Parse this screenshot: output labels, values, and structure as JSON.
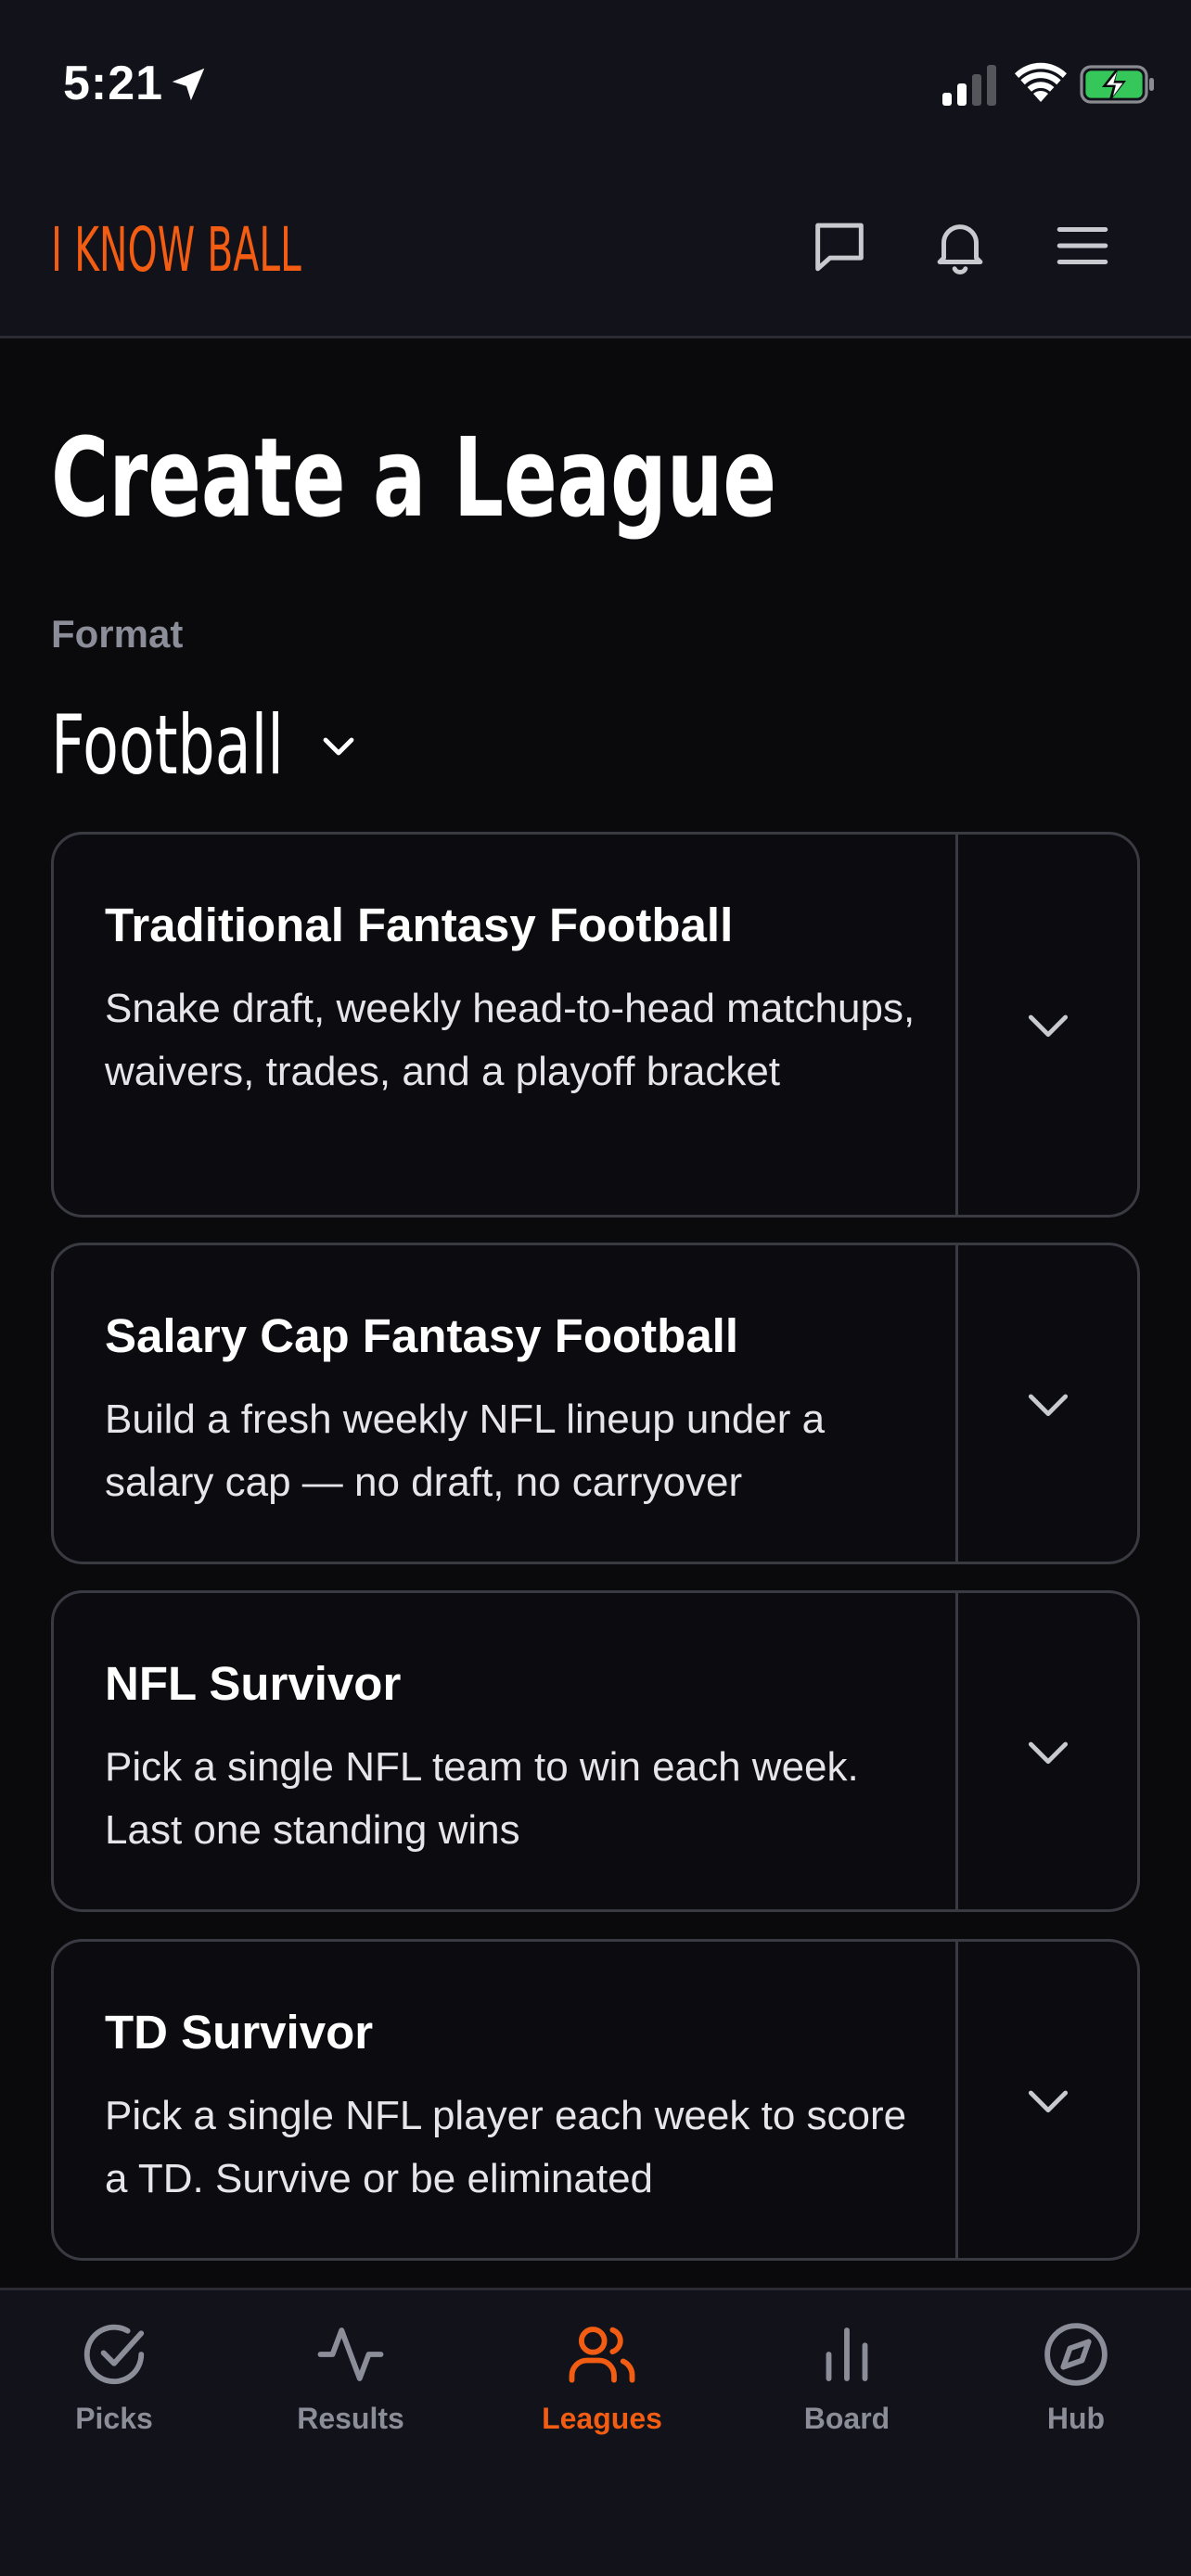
{
  "status_bar": {
    "time": "5:21"
  },
  "header": {
    "brand": "I KNOW BALL"
  },
  "page": {
    "title": "Create a League",
    "format_label": "Format",
    "format_value": "Football"
  },
  "leagues": [
    {
      "title": "Traditional Fantasy Football",
      "description": "Snake draft, weekly head-to-head matchups, waivers, trades, and a playoff bracket"
    },
    {
      "title": "Salary Cap Fantasy Football",
      "description": "Build a fresh weekly NFL lineup under a salary cap — no draft, no carryover"
    },
    {
      "title": "NFL Survivor",
      "description": "Pick a single NFL team to win each week. Last one standing wins"
    },
    {
      "title": "TD Survivor",
      "description": "Pick a single NFL player each week to score a TD. Survive or be eliminated"
    }
  ],
  "nav": {
    "items": [
      {
        "label": "Picks",
        "icon": "check-circle-icon"
      },
      {
        "label": "Results",
        "icon": "activity-icon"
      },
      {
        "label": "Leagues",
        "icon": "users-icon",
        "active": true
      },
      {
        "label": "Board",
        "icon": "bar-chart-icon"
      },
      {
        "label": "Hub",
        "icon": "compass-icon"
      }
    ]
  },
  "colors": {
    "accent": "#f25c13",
    "background": "#0a0a0d",
    "panel": "#12131a",
    "border": "#3a3b42",
    "muted": "#8b8e98"
  }
}
